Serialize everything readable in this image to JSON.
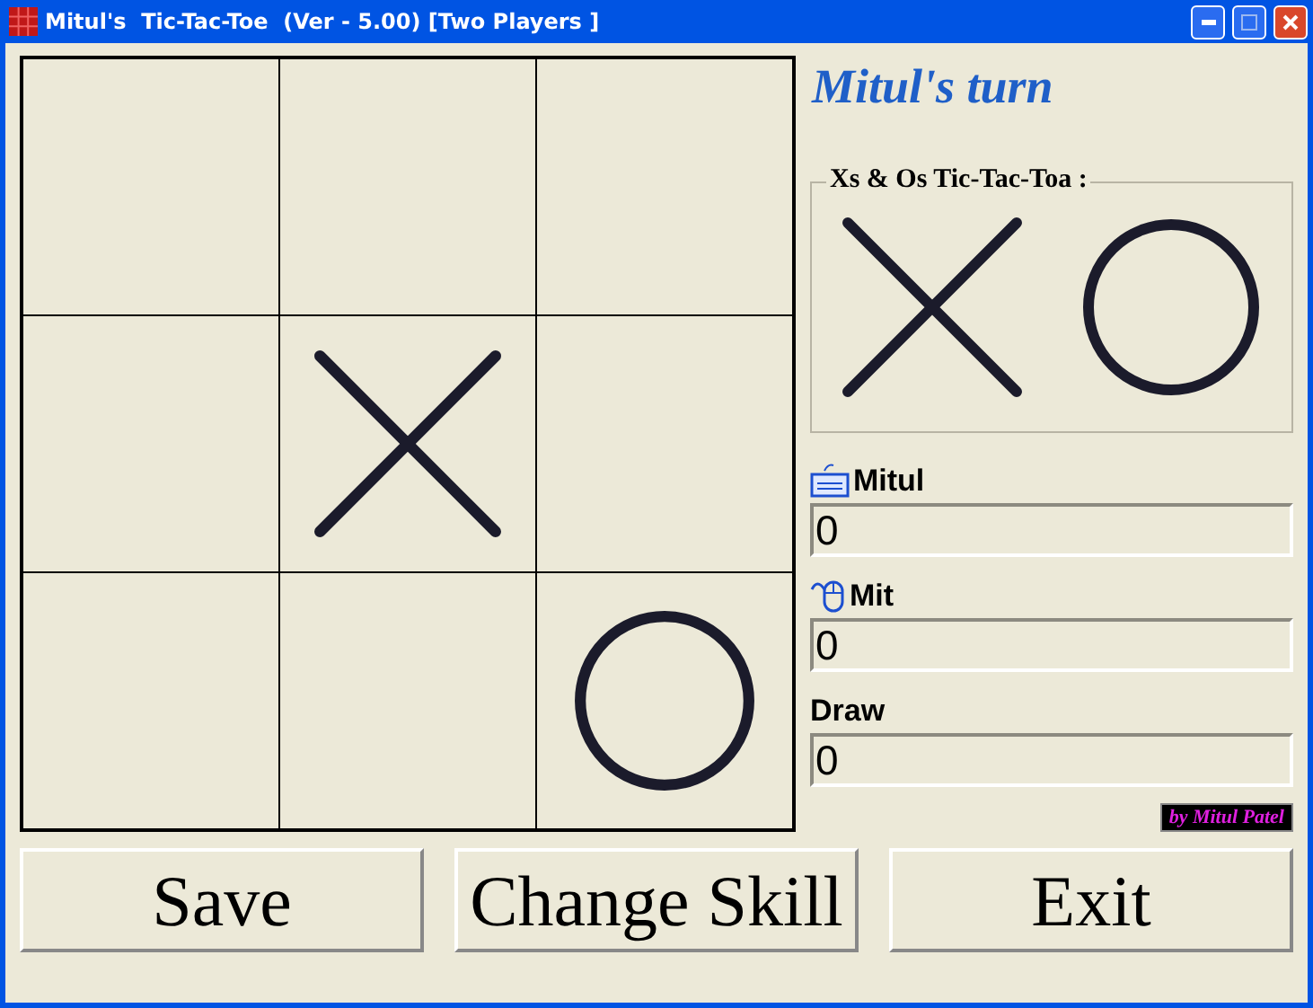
{
  "window": {
    "title": "Mitul's  Tic-Tac-Toe  (Ver - 5.00) [Two Players ]"
  },
  "board": [
    {
      "kind": "empty"
    },
    {
      "kind": "empty"
    },
    {
      "kind": "empty"
    },
    {
      "kind": "empty"
    },
    {
      "kind": "cross"
    },
    {
      "kind": "empty"
    },
    {
      "kind": "empty"
    },
    {
      "kind": "empty"
    },
    {
      "kind": "nought"
    }
  ],
  "turn": "Mitul's turn",
  "legend": {
    "title": "Xs & Os Tic-Tac-Toa :"
  },
  "scores": [
    {
      "name": "Mitul",
      "kind": "keyboard",
      "value": "0"
    },
    {
      "name": "Mit",
      "kind": "mouse",
      "value": "0"
    },
    {
      "name": "Draw",
      "kind": "plain",
      "value": "0"
    }
  ],
  "credit": "by Mitul Patel",
  "buttons": [
    "Save",
    "Change Skill",
    "Exit"
  ]
}
